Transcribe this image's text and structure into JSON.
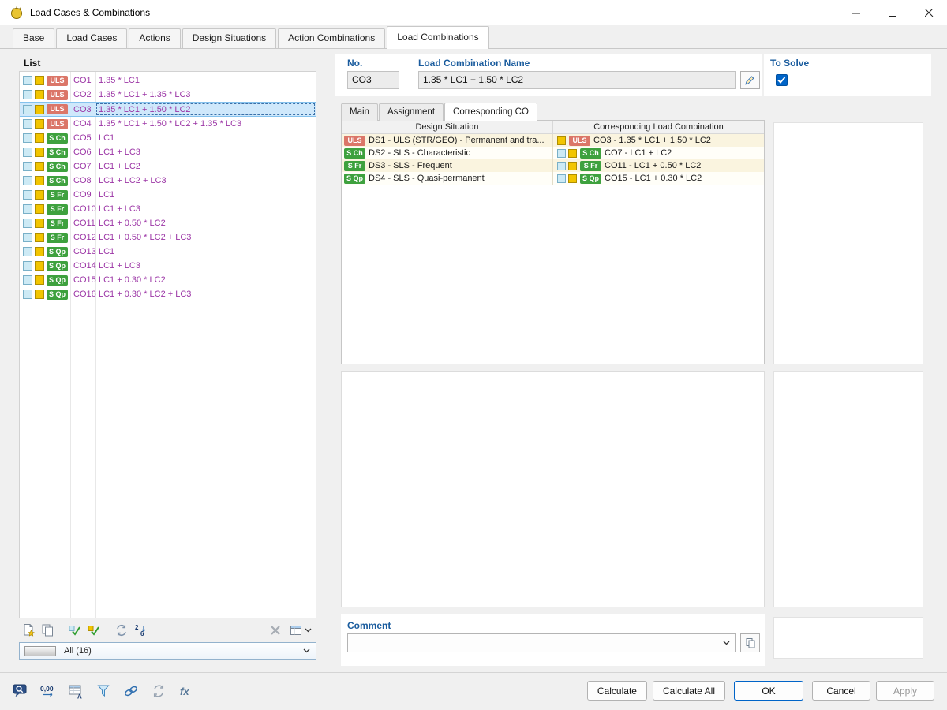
{
  "window": {
    "title": "Load Cases & Combinations"
  },
  "tabs": [
    {
      "label": "Base",
      "active": false
    },
    {
      "label": "Load Cases",
      "active": false
    },
    {
      "label": "Actions",
      "active": false
    },
    {
      "label": "Design Situations",
      "active": false
    },
    {
      "label": "Action Combinations",
      "active": false
    },
    {
      "label": "Load Combinations",
      "active": true
    }
  ],
  "list": {
    "header": "List",
    "filter_value": "All (16)",
    "items": [
      {
        "id": "CO1",
        "badge": "ULS",
        "type": "uls",
        "formula": "1.35 * LC1",
        "selected": false
      },
      {
        "id": "CO2",
        "badge": "ULS",
        "type": "uls",
        "formula": "1.35 * LC1 + 1.35 * LC3",
        "selected": false
      },
      {
        "id": "CO3",
        "badge": "ULS",
        "type": "uls",
        "formula": "1.35 * LC1 + 1.50 * LC2",
        "selected": true
      },
      {
        "id": "CO4",
        "badge": "ULS",
        "type": "uls",
        "formula": "1.35 * LC1 + 1.50 * LC2 + 1.35 * LC3",
        "selected": false
      },
      {
        "id": "CO5",
        "badge": "S Ch",
        "type": "sls",
        "formula": "LC1",
        "selected": false
      },
      {
        "id": "CO6",
        "badge": "S Ch",
        "type": "sls",
        "formula": "LC1 + LC3",
        "selected": false
      },
      {
        "id": "CO7",
        "badge": "S Ch",
        "type": "sls",
        "formula": "LC1 + LC2",
        "selected": false
      },
      {
        "id": "CO8",
        "badge": "S Ch",
        "type": "sls",
        "formula": "LC1 + LC2 + LC3",
        "selected": false
      },
      {
        "id": "CO9",
        "badge": "S Fr",
        "type": "sls",
        "formula": "LC1",
        "selected": false
      },
      {
        "id": "CO10",
        "badge": "S Fr",
        "type": "sls",
        "formula": "LC1 + LC3",
        "selected": false
      },
      {
        "id": "CO11",
        "badge": "S Fr",
        "type": "sls",
        "formula": "LC1 + 0.50 * LC2",
        "selected": false
      },
      {
        "id": "CO12",
        "badge": "S Fr",
        "type": "sls",
        "formula": "LC1 + 0.50 * LC2 + LC3",
        "selected": false
      },
      {
        "id": "CO13",
        "badge": "S Qp",
        "type": "sls",
        "formula": "LC1",
        "selected": false
      },
      {
        "id": "CO14",
        "badge": "S Qp",
        "type": "sls",
        "formula": "LC1 + LC3",
        "selected": false
      },
      {
        "id": "CO15",
        "badge": "S Qp",
        "type": "sls",
        "formula": "LC1 + 0.30 * LC2",
        "selected": false
      },
      {
        "id": "CO16",
        "badge": "S Qp",
        "type": "sls",
        "formula": "LC1 + 0.30 * LC2 + LC3",
        "selected": false
      }
    ]
  },
  "details": {
    "no_label": "No.",
    "no_value": "CO3",
    "name_label": "Load Combination Name",
    "name_value": "1.35 * LC1 + 1.50 * LC2",
    "to_solve_label": "To Solve",
    "to_solve_checked": true,
    "subtabs": [
      {
        "label": "Main",
        "active": false
      },
      {
        "label": "Assignment",
        "active": false
      },
      {
        "label": "Corresponding CO",
        "active": true
      }
    ],
    "table": {
      "col1": "Design Situation",
      "col2": "Corresponding Load Combination",
      "rows": [
        {
          "ds_badge": "ULS",
          "ds_type": "uls",
          "ds_text": "DS1 - ULS (STR/GEO) - Permanent and tra...",
          "co_squares": [
            "yellow"
          ],
          "co_badge": "ULS",
          "co_type": "uls",
          "co_text": "CO3 - 1.35 * LC1 + 1.50 * LC2"
        },
        {
          "ds_badge": "S Ch",
          "ds_type": "sls",
          "ds_text": "DS2 - SLS - Characteristic",
          "co_squares": [
            "cyan",
            "yellow"
          ],
          "co_badge": "S Ch",
          "co_type": "sls",
          "co_text": "CO7 - LC1 + LC2"
        },
        {
          "ds_badge": "S Fr",
          "ds_type": "sls",
          "ds_text": "DS3 - SLS - Frequent",
          "co_squares": [
            "cyan",
            "yellow"
          ],
          "co_badge": "S Fr",
          "co_type": "sls",
          "co_text": "CO11 - LC1 + 0.50 * LC2"
        },
        {
          "ds_badge": "S Qp",
          "ds_type": "sls",
          "ds_text": "DS4 - SLS - Quasi-permanent",
          "co_squares": [
            "cyan",
            "yellow"
          ],
          "co_badge": "S Qp",
          "co_type": "sls",
          "co_text": "CO15 - LC1 + 0.30 * LC2"
        }
      ]
    },
    "comment_label": "Comment",
    "comment_value": ""
  },
  "footer": {
    "buttons": [
      {
        "label": "Calculate",
        "style": "normal"
      },
      {
        "label": "Calculate All",
        "style": "normal"
      },
      {
        "label": "OK",
        "style": "default"
      },
      {
        "label": "Cancel",
        "style": "normal"
      },
      {
        "label": "Apply",
        "style": "disabled"
      }
    ]
  },
  "icons": {
    "titlebar": [
      "app-icon",
      "minimize-icon",
      "maximize-icon",
      "close-icon"
    ],
    "list_toolbar": [
      "new-combination-icon",
      "copy-combination-icon",
      "check-all-icon",
      "check-selection-icon",
      "swap-icon",
      "renumber-icon",
      "delete-icon",
      "table-view-icon"
    ],
    "bottom_toolbar": [
      "find-icon",
      "decimal-places-icon",
      "units-settings-icon",
      "filter-icon",
      "link-icon",
      "regenerate-icon",
      "formula-icon"
    ],
    "misc": [
      "edit-name-icon",
      "copy-comment-icon",
      "dropdown-chevron-icon",
      "checkmark-icon"
    ]
  },
  "colors": {
    "accent_blue": "#1a5c9e",
    "selection": "#cfe8fb",
    "uls_badge": "#db7668",
    "sls_badge": "#3ea13e",
    "square_yellow": "#f2c500",
    "square_cyan": "#cdeaf5",
    "text_purple": "#9c36a6",
    "default_button_border": "#0064c8"
  }
}
